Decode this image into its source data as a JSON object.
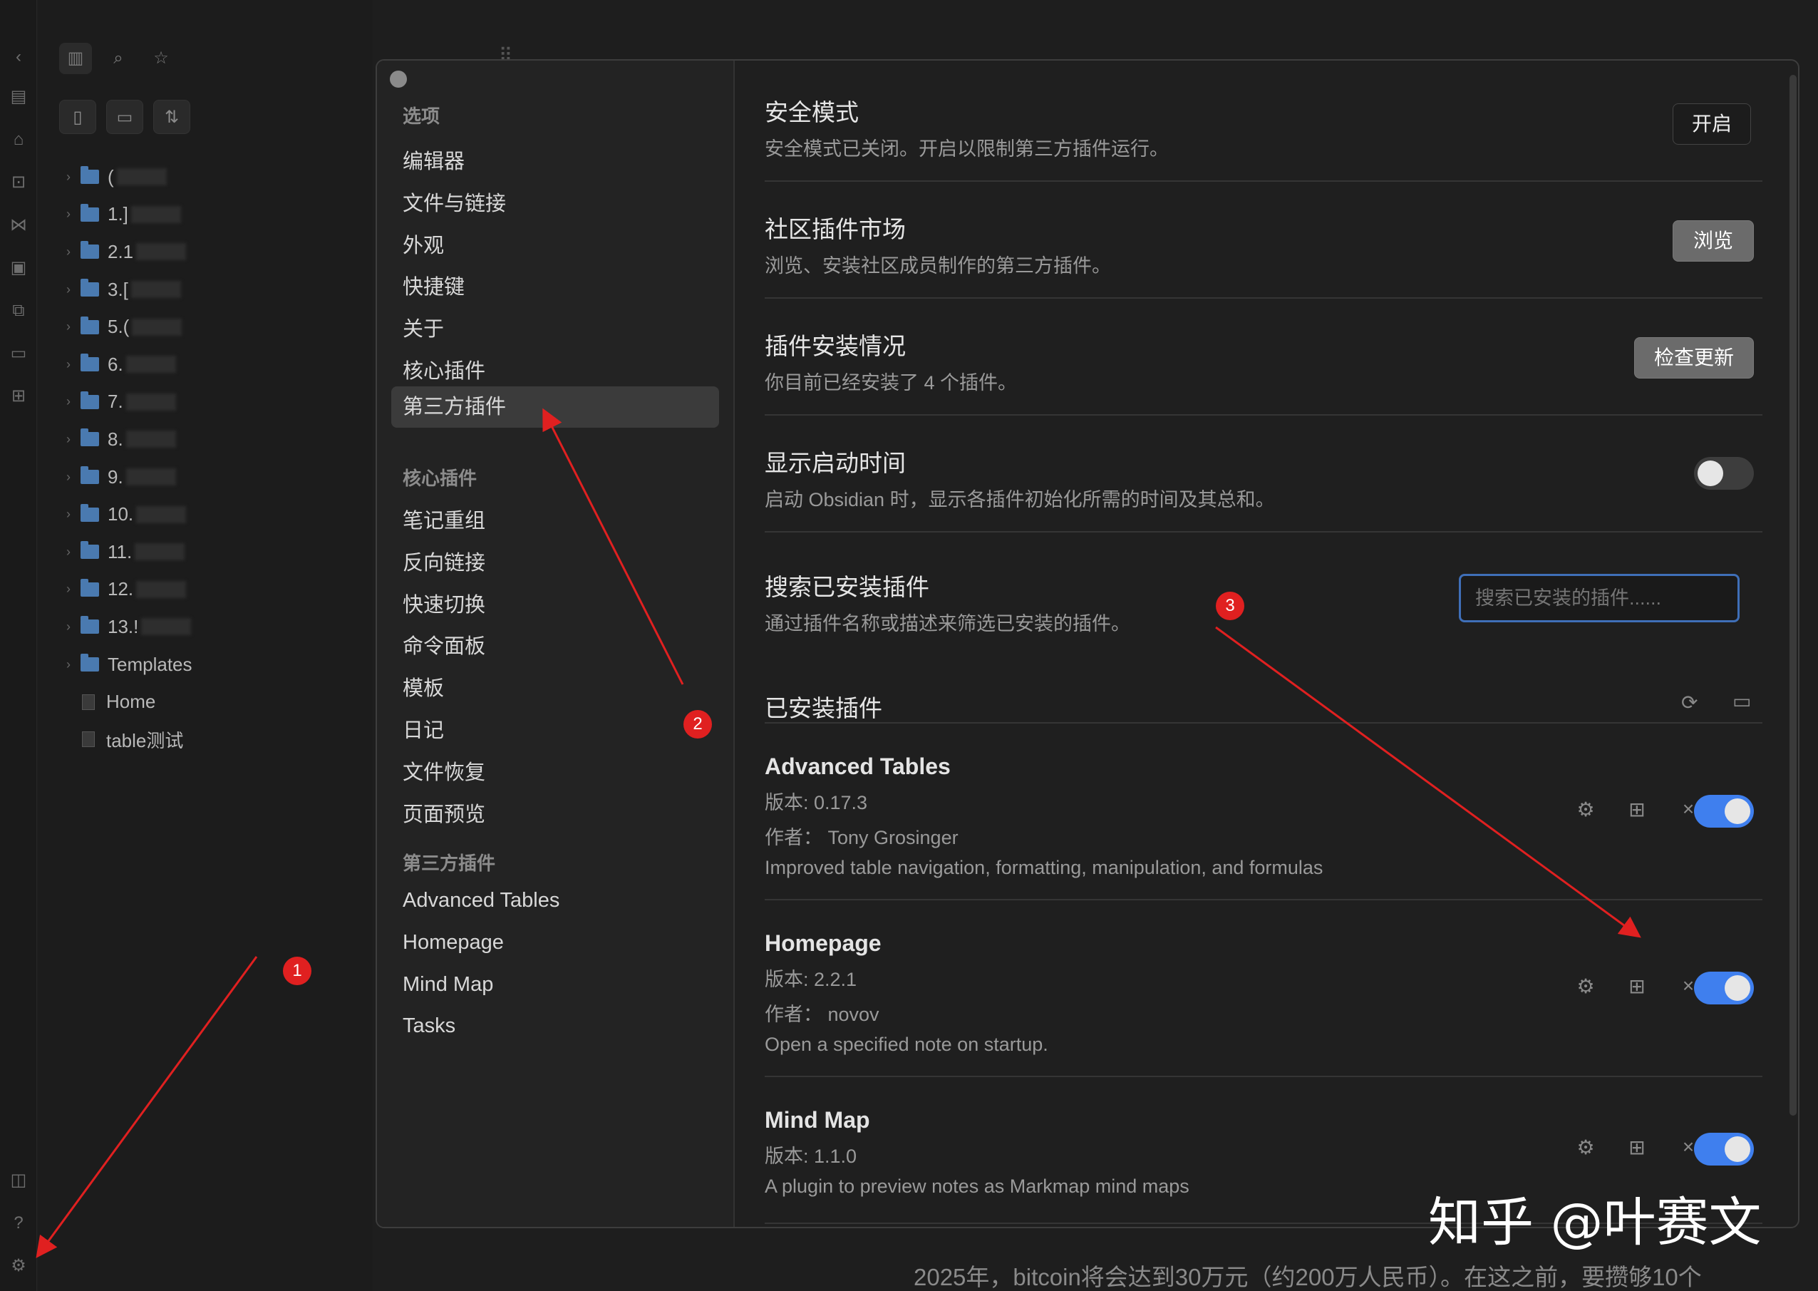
{
  "ribbon": {
    "icons": [
      "chevron-left-icon",
      "table-icon",
      "home-icon",
      "file-search-icon",
      "graph-icon",
      "calendar-icon",
      "copy-icon",
      "terminal-icon",
      "grid-icon",
      "book-icon",
      "help-icon",
      "settings-icon"
    ]
  },
  "sidebar": {
    "tree": [
      {
        "type": "folder",
        "label": "("
      },
      {
        "type": "folder",
        "label": "1.]"
      },
      {
        "type": "folder",
        "label": "2.1"
      },
      {
        "type": "folder",
        "label": "3.["
      },
      {
        "type": "folder",
        "label": "5.("
      },
      {
        "type": "folder",
        "label": "6."
      },
      {
        "type": "folder",
        "label": "7."
      },
      {
        "type": "folder",
        "label": "8."
      },
      {
        "type": "folder",
        "label": "9."
      },
      {
        "type": "folder",
        "label": "10."
      },
      {
        "type": "folder",
        "label": "11."
      },
      {
        "type": "folder",
        "label": "12."
      },
      {
        "type": "folder",
        "label": "13.!"
      },
      {
        "type": "folder",
        "label": "Templates"
      },
      {
        "type": "file",
        "label": "Home"
      },
      {
        "type": "file",
        "label": "table测试"
      }
    ]
  },
  "modal": {
    "nav": {
      "head_options": "选项",
      "options": [
        "编辑器",
        "文件与链接",
        "外观",
        "快捷键",
        "关于",
        "核心插件",
        "第三方插件"
      ],
      "head_core": "核心插件",
      "core": [
        "笔记重组",
        "反向链接",
        "快速切换",
        "命令面板",
        "模板",
        "日记",
        "文件恢复",
        "页面预览"
      ],
      "head_third": "第三方插件",
      "third": [
        "Advanced Tables",
        "Homepage",
        "Mind Map",
        "Tasks"
      ]
    },
    "settings": {
      "safe_mode_title": "安全模式",
      "safe_mode_desc": "安全模式已关闭。开启以限制第三方插件运行。",
      "safe_mode_btn": "开启",
      "market_title": "社区插件市场",
      "market_desc": "浏览、安装社区成员制作的第三方插件。",
      "market_btn": "浏览",
      "install_title": "插件安装情况",
      "install_desc": "你目前已经安装了 4 个插件。",
      "install_btn": "检查更新",
      "startup_title": "显示启动时间",
      "startup_desc": "启动 Obsidian 时，显示各插件初始化所需的时间及其总和。",
      "search_title": "搜索已安装插件",
      "search_desc": "通过插件名称或描述来筛选已安装的插件。",
      "search_placeholder": "搜索已安装的插件......",
      "installed_header": "已安装插件"
    },
    "plugins": [
      {
        "name": "Advanced Tables",
        "version": "版本: 0.17.3",
        "author": "作者： Tony Grosinger",
        "desc": "Improved table navigation, formatting, manipulation, and formulas"
      },
      {
        "name": "Homepage",
        "version": "版本: 2.2.1",
        "author": "作者： novov",
        "desc": "Open a specified note on startup."
      },
      {
        "name": "Mind Map",
        "version": "版本: 1.1.0",
        "desc": "A plugin to preview notes as Markmap mind maps"
      }
    ]
  },
  "annotations": {
    "badge1": "1",
    "badge2": "2",
    "badge3": "3",
    "color": "#e02020"
  },
  "watermark": "知乎 @叶赛文",
  "bottom_text": "2025年，bitcoin将会达到30万元（约200万人民币）。在这之前，要攒够10个",
  "colors": {
    "accent": "#3f7fee",
    "search_border": "#3f6fb8"
  }
}
